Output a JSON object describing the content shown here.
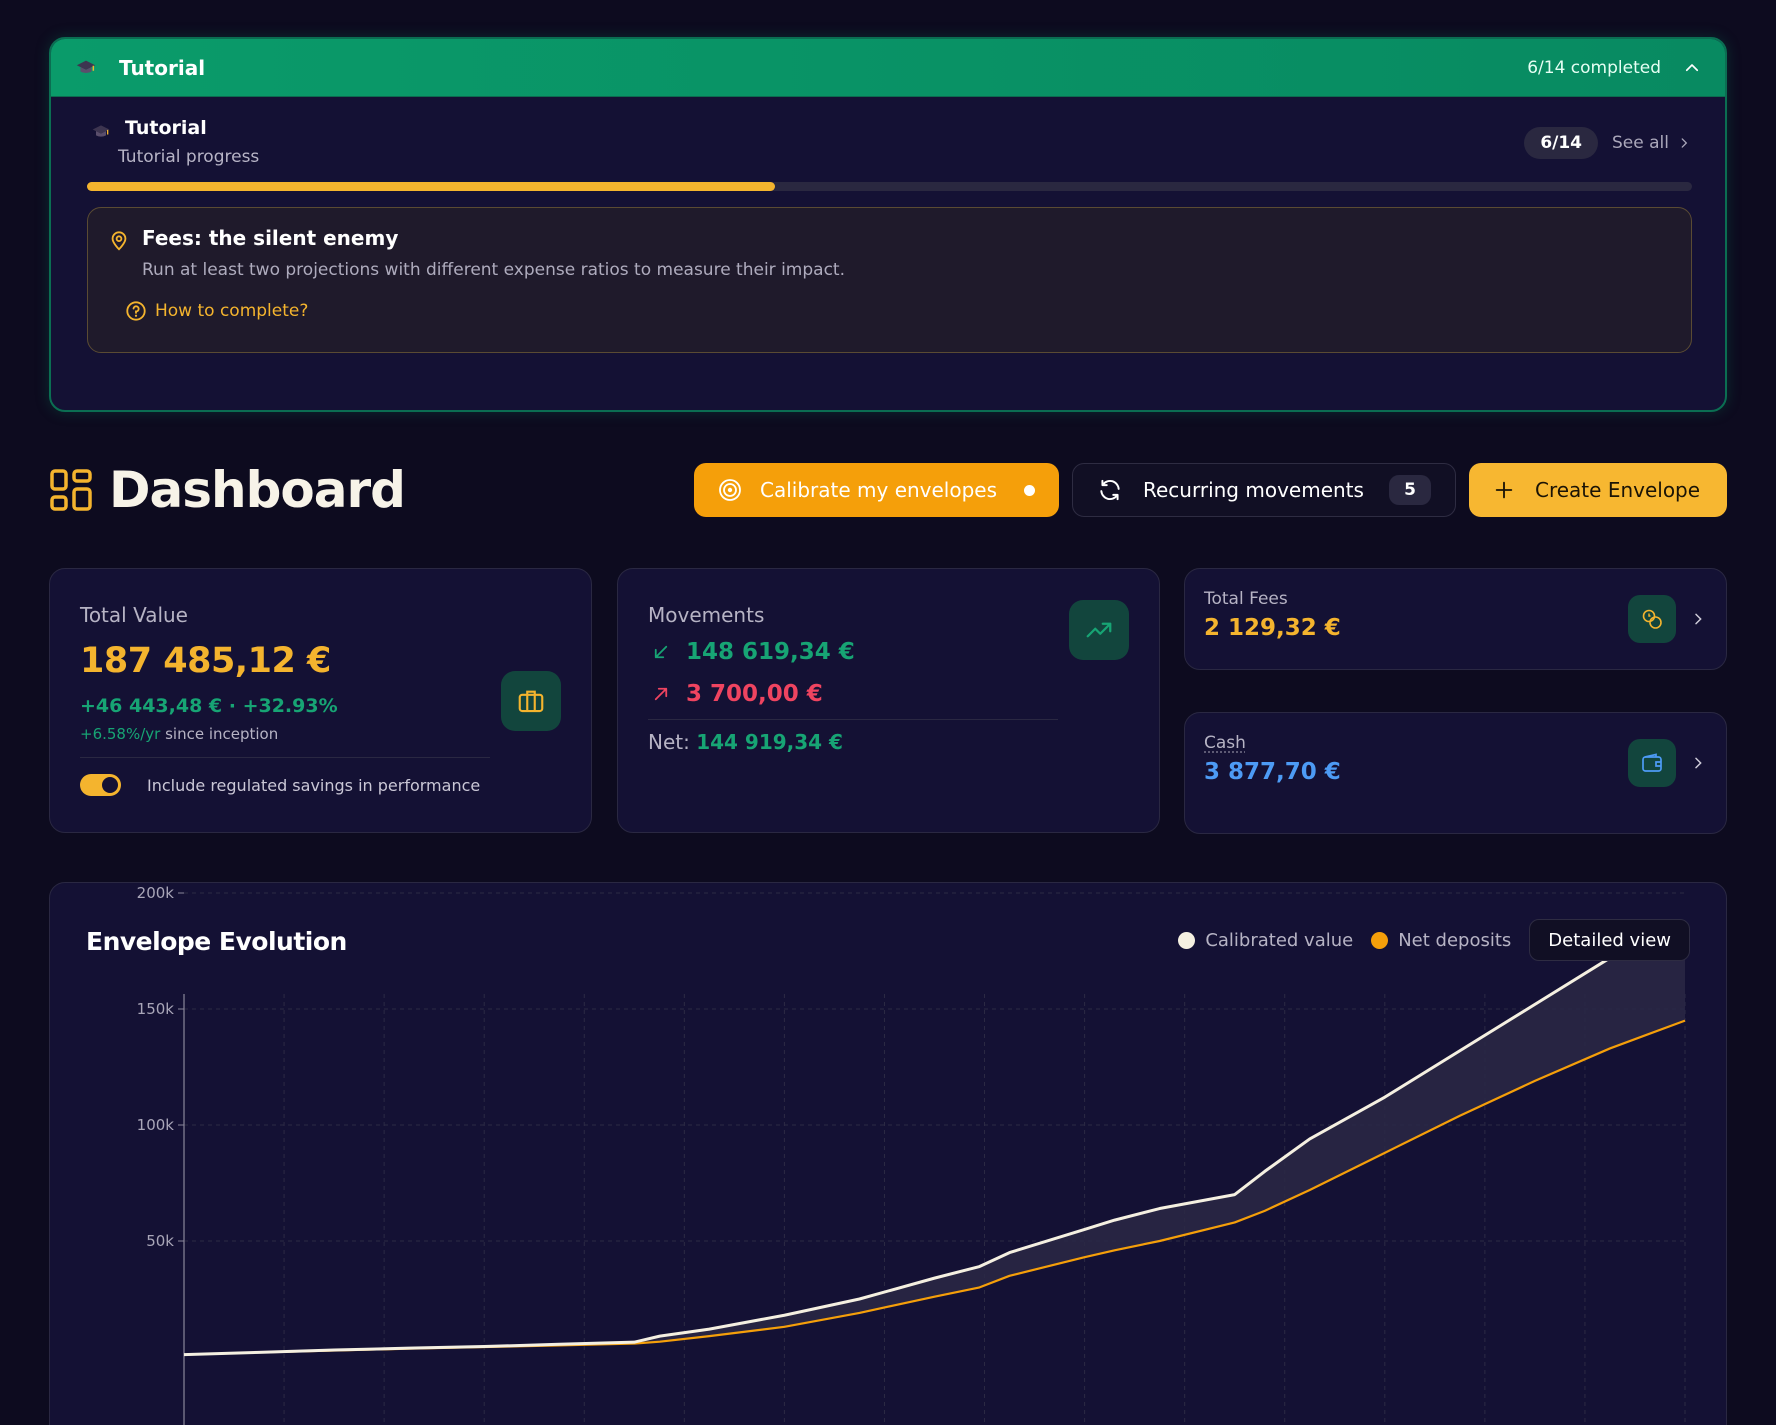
{
  "tutorial": {
    "header_title": "Tutorial",
    "header_status": "6/14 completed",
    "title": "Tutorial",
    "subtitle": "Tutorial progress",
    "count": "6/14",
    "see_all": "See all",
    "progress": 0.4286,
    "task": {
      "title": "Fees: the silent enemy",
      "description": "Run at least two projections with different expense ratios to measure their impact.",
      "how": "How to complete?"
    }
  },
  "dashboard": {
    "title": "Dashboard",
    "calibrate_label": "Calibrate my envelopes",
    "recurring_label": "Recurring movements",
    "recurring_count": "5",
    "create_label": "Create Envelope"
  },
  "total_value": {
    "label": "Total Value",
    "value": "187 485,12 €",
    "gain": "+46 443,48 € · +32.93%",
    "rate": "+6.58%/yr",
    "since": " since inception",
    "toggle_label": "Include regulated savings in performance",
    "toggle_on": true
  },
  "movements": {
    "label": "Movements",
    "inflow": "148 619,34 €",
    "outflow": "3 700,00 €",
    "net_label": "Net: ",
    "net_value": "144 919,34 €"
  },
  "fees": {
    "label": "Total Fees",
    "value": "2 129,32 €"
  },
  "cash": {
    "label": "Cash",
    "value": "3 877,70 €"
  },
  "chart_section": {
    "title": "Envelope Evolution",
    "legend_calibrated": "Calibrated value",
    "legend_deposits": "Net deposits",
    "detailed_view": "Detailed view"
  },
  "colors": {
    "accent_orange": "#f59f0a",
    "accent_yellow": "#f7b731",
    "positive": "#17a474",
    "negative": "#ef4460",
    "cash_blue": "#4d9bf5",
    "calibrated_line": "#f5f0e1",
    "deposits_line": "#f59f0a"
  },
  "chart_data": {
    "type": "line",
    "title": "",
    "xlabel": "",
    "ylabel": "",
    "ylim": [
      0,
      200000
    ],
    "yticks": [
      "200k",
      "150k",
      "100k",
      "50k"
    ],
    "ytick_values": [
      200000,
      150000,
      100000,
      50000
    ],
    "x_gridlines": 15,
    "grid": true,
    "legend_position": "top-right",
    "x": [
      0.0,
      0.05,
      0.1,
      0.15,
      0.2,
      0.25,
      0.3,
      0.317,
      0.35,
      0.4,
      0.45,
      0.5,
      0.53,
      0.55,
      0.6,
      0.62,
      0.65,
      0.7,
      0.72,
      0.75,
      0.8,
      0.85,
      0.9,
      0.95,
      1.0
    ],
    "series": [
      {
        "name": "Calibrated value",
        "color": "#f5f0e1",
        "values": [
          1000,
          2000,
          3000,
          3800,
          4500,
          5500,
          6400,
          9000,
          12000,
          18000,
          25000,
          34000,
          39000,
          45000,
          55000,
          59000,
          64000,
          70000,
          80000,
          94000,
          112000,
          132000,
          152000,
          172000,
          187500
        ]
      },
      {
        "name": "Net deposits",
        "color": "#f59f0a",
        "values": [
          1000,
          2000,
          2800,
          3600,
          4300,
          5000,
          5800,
          6600,
          9000,
          13000,
          19000,
          26000,
          30000,
          35000,
          43000,
          46000,
          50000,
          58000,
          63000,
          72000,
          88000,
          104000,
          119000,
          133000,
          145000
        ]
      }
    ]
  }
}
